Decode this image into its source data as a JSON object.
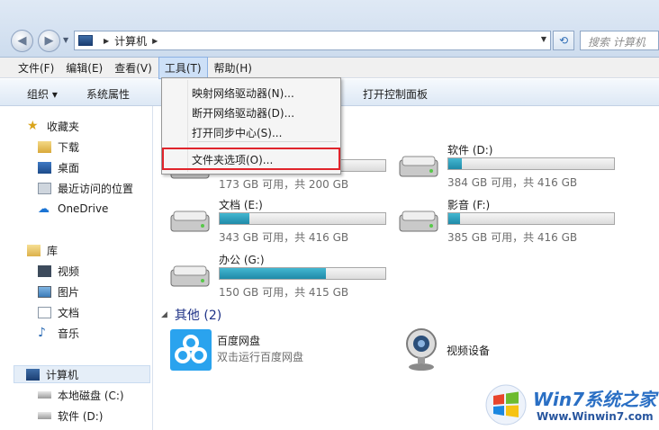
{
  "address": {
    "crumb": "计算机",
    "search_placeholder": "搜索 计算机"
  },
  "menubar": [
    "文件(F)",
    "编辑(E)",
    "查看(V)",
    "工具(T)",
    "帮助(H)"
  ],
  "toolbar": {
    "organize": "组织",
    "properties": "系统属性",
    "control_panel": "打开控制面板"
  },
  "sidebar": {
    "favorites": "收藏夹",
    "fav_items": [
      "下载",
      "桌面",
      "最近访问的位置"
    ],
    "onedrive": "OneDrive",
    "libraries": "库",
    "lib_items": [
      "视频",
      "图片",
      "文档",
      "音乐"
    ],
    "computer": "计算机",
    "computer_items": [
      "本地磁盘 (C:)",
      "软件 (D:)"
    ]
  },
  "drives": [
    {
      "name": "",
      "free": "173 GB 可用，共 200 GB",
      "used_fraction": 0.13
    },
    {
      "name": "软件 (D:)",
      "free": "384 GB 可用，共 416 GB",
      "used_fraction": 0.08
    },
    {
      "name": "文档 (E:)",
      "free": "343 GB 可用，共 416 GB",
      "used_fraction": 0.18
    },
    {
      "name": "影音 (F:)",
      "free": "385 GB 可用，共 416 GB",
      "used_fraction": 0.07
    },
    {
      "name": "办公 (G:)",
      "free": "150 GB 可用，共 415 GB",
      "used_fraction": 0.64
    }
  ],
  "other_group": {
    "title": "其他 (2)",
    "baidu_name": "百度网盘",
    "baidu_desc": "双击运行百度网盘",
    "video_device": "视频设备"
  },
  "tools_menu": [
    "映射网络驱动器(N)...",
    "断开网络驱动器(D)...",
    "打开同步中心(S)...",
    "文件夹选项(O)..."
  ],
  "watermark": {
    "brand": "Win7系统之家",
    "url": "Www.Winwin7.com"
  },
  "colors": {
    "accent": "#2f6db5",
    "highlight_box": "#e0242b",
    "bar_fill": "#1f8aa8"
  }
}
